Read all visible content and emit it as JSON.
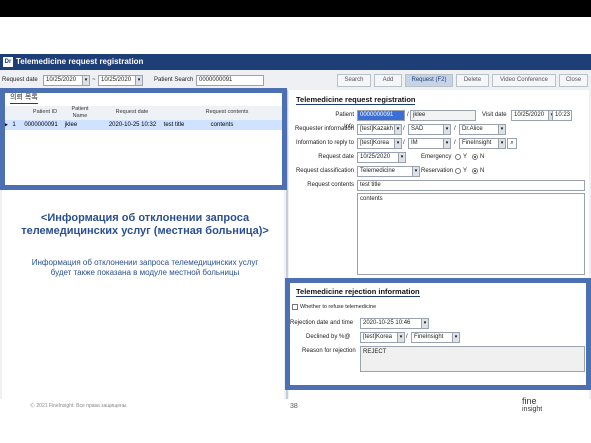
{
  "window": {
    "title": "Telemedicine request registration",
    "logo": "Dr"
  },
  "toolbar": {
    "request_date_label": "Request date",
    "date_from": "10/25/2020",
    "separator": "~",
    "date_to": "10/25/2020",
    "patient_search_label": "Patient Search",
    "patient_search_value": "0000000091",
    "buttons": [
      "Search",
      "Add",
      "Request (F2)",
      "Delete",
      "Video Conference",
      "Close"
    ]
  },
  "list": {
    "title": "의뢰 목록",
    "headers": [
      "Patient ID",
      "Patient Name",
      "Request date",
      "Request contents"
    ],
    "rows": [
      {
        "marker": "▶",
        "num": "1",
        "id": "0000000091",
        "name": "jklee",
        "date": "2020-10-25 10:32",
        "contents1": "test title",
        "contents2": "contents"
      }
    ]
  },
  "form": {
    "title": "Telemedicine request registration",
    "patient_info_label": "Patient Info",
    "patient_id": "0000000091",
    "patient_name": "jklee",
    "visit_date_label": "Visit date",
    "visit_date": "10/25/2020",
    "visit_time": "10:23",
    "requester_label": "Requester information",
    "requester_hospital": "[test]Kazakh",
    "requester_dept": "SAD",
    "requester_doctor": "Dr.Alice",
    "reply_label": "Information to reply to",
    "reply_hospital": "[test]Korea",
    "reply_dept": "IM",
    "reply_doctor": "FineInsight",
    "request_date_label": "Request date",
    "request_date": "10/25/2020",
    "emergency_label": "Emergency",
    "yes": "Y",
    "no": "N",
    "classification_label": "Request classification",
    "classification": "Telemedicine",
    "reservation_label": "Reservation",
    "contents_label": "Request contents",
    "contents_title": "test title",
    "contents_body": "contents",
    "slash": "/"
  },
  "rejection": {
    "title": "Telemedicine rejection information",
    "refuse_label": "Whether to refuse telemedicine",
    "datetime_label": "Rejection date and time",
    "datetime": "2020-10-25 10:46",
    "declined_label": "Declined by %@",
    "declined_hospital": "[test]Korea",
    "declined_doctor": "FineInsight",
    "reason_label": "Reason for rejection",
    "reason": "REJECT"
  },
  "overlay": {
    "heading": "<Информация об отклонении запроса телемедицинских услуг (местная больница)>",
    "body": "Информация об отклонении запроса телемедицинских услуг будет также показана в модуле местной больницы"
  },
  "footer": {
    "copyright": "Ⓒ 2021 FineInsight. Все права защищены.",
    "page": "38",
    "brand1": "fine",
    "brand2": "insight"
  },
  "colors": {
    "accent": "#4d6fb3",
    "titlebar": "#1e3e78",
    "selection": "#cfe2ff"
  }
}
